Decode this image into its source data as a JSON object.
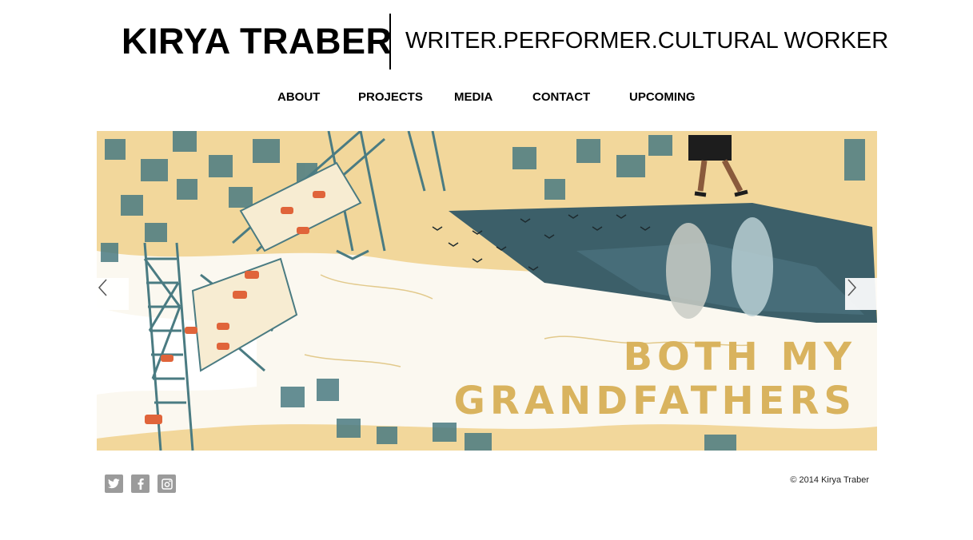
{
  "header": {
    "site_name": "KIRYA TRABER",
    "tagline": "WRITER.PERFORMER.CULTURAL WORKER"
  },
  "nav": {
    "items": [
      {
        "label": "ABOUT"
      },
      {
        "label": "PROJECTS"
      },
      {
        "label": "MEDIA"
      },
      {
        "label": "CONTACT"
      },
      {
        "label": "UPCOMING"
      }
    ]
  },
  "slider": {
    "title_line1": "BOTH MY",
    "title_line2": "GRANDFATHERS",
    "prev_icon": "chevron-left-icon",
    "next_icon": "chevron-right-icon",
    "colors": {
      "sky": "#f2d79b",
      "water": "#ffffff",
      "ink": "#4a7b82",
      "cars": "#e0643a",
      "title": "#d9b35e"
    }
  },
  "footer": {
    "social": [
      {
        "icon": "twitter-icon"
      },
      {
        "icon": "facebook-icon"
      },
      {
        "icon": "instagram-icon"
      }
    ],
    "copyright": "© 2014 Kirya Traber"
  }
}
